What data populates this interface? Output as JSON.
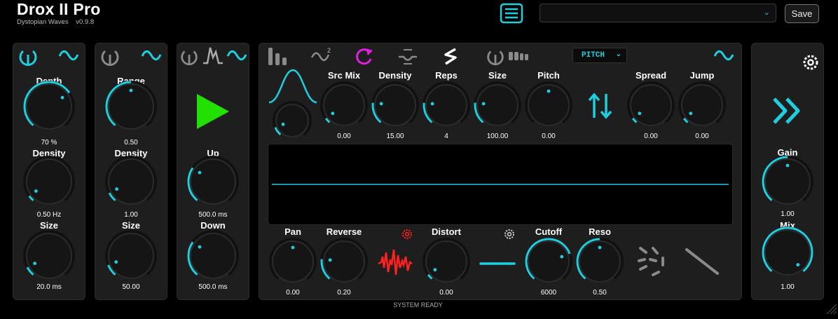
{
  "app": {
    "title": "Drox II Pro",
    "vendor": "Dystopian Waves",
    "version": "v0.9.8"
  },
  "preset": {
    "value": "",
    "save_label": "Save"
  },
  "colors": {
    "accent": "#1ecfe0",
    "bg": "#000000",
    "panel": "#1e1e1e",
    "play": "#22e000",
    "magenta": "#e020e0",
    "red": "#ff2020"
  },
  "panel1": {
    "knobs": [
      {
        "label": "Depth",
        "value": "70 %",
        "level": 0.7
      },
      {
        "label": "Density",
        "value": "0.50 Hz",
        "level": 0.05
      },
      {
        "label": "Size",
        "value": "20.0 ms",
        "level": 0.08
      }
    ]
  },
  "panel2": {
    "knobs": [
      {
        "label": "Range",
        "value": "0.50",
        "level": 0.5
      },
      {
        "label": "Density",
        "value": "1.00",
        "level": 0.08
      },
      {
        "label": "Size",
        "value": "50.00",
        "level": 0.1
      }
    ]
  },
  "panel3": {
    "knobs": [
      {
        "label": "Up",
        "value": "500.0 ms",
        "level": 0.3
      },
      {
        "label": "Down",
        "value": "500.0 ms",
        "level": 0.3
      }
    ]
  },
  "main": {
    "pitch_mode": "PITCH",
    "envelope_knob_level": 0.1,
    "top_knobs": [
      {
        "label": "Src Mix",
        "value": "0.00",
        "level": 0.05
      },
      {
        "label": "Density",
        "value": "15.00",
        "level": 0.2
      },
      {
        "label": "Reps",
        "value": "4",
        "level": 0.2
      },
      {
        "label": "Size",
        "value": "100.00",
        "level": 0.2
      },
      {
        "label": "Pitch",
        "value": "0.00",
        "level": 0.5
      },
      {
        "label": "Spread",
        "value": "0.00",
        "level": 0.05
      },
      {
        "label": "Jump",
        "value": "0.00",
        "level": 0.05
      }
    ],
    "bottom_knobs": [
      {
        "label": "Pan",
        "value": "0.00",
        "level": 0.5
      },
      {
        "label": "Reverse",
        "value": "0.20",
        "level": 0.2
      },
      {
        "label": "Distort",
        "value": "0.00",
        "level": 0.05
      },
      {
        "label": "Cutoff",
        "value": "6000",
        "level": 0.75
      },
      {
        "label": "Reso",
        "value": "0.50",
        "level": 0.5
      }
    ]
  },
  "output": {
    "knobs": [
      {
        "label": "Gain",
        "value": "1.00",
        "level": 0.5
      },
      {
        "label": "Mix",
        "value": "1.00",
        "level": 1.0
      }
    ]
  },
  "status": "SYSTEM READY"
}
